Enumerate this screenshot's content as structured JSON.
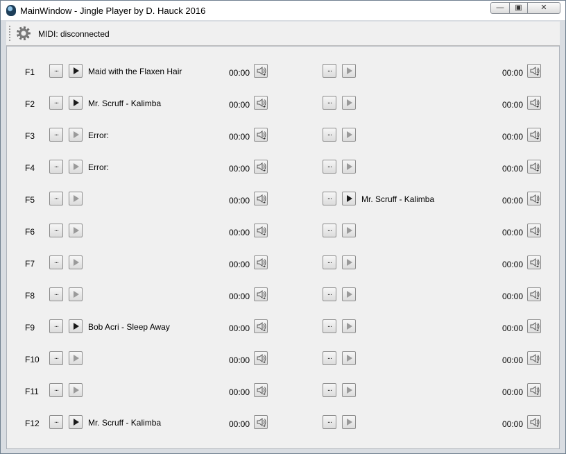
{
  "window": {
    "title": "MainWindow - Jingle Player by D. Hauck 2016"
  },
  "toolbar": {
    "midi_status": "MIDI: disconnected"
  },
  "button_labels": {
    "browse": "..."
  },
  "rows": [
    {
      "key": "F1",
      "left": {
        "track": "Maid with the Flaxen Hair",
        "loaded": true,
        "time": "00:00"
      },
      "right": {
        "track": "",
        "loaded": false,
        "time": "00:00"
      }
    },
    {
      "key": "F2",
      "left": {
        "track": "Mr. Scruff - Kalimba",
        "loaded": true,
        "time": "00:00"
      },
      "right": {
        "track": "",
        "loaded": false,
        "time": "00:00"
      }
    },
    {
      "key": "F3",
      "left": {
        "track": "Error:",
        "loaded": false,
        "time": "00:00"
      },
      "right": {
        "track": "",
        "loaded": false,
        "time": "00:00"
      }
    },
    {
      "key": "F4",
      "left": {
        "track": "Error:",
        "loaded": false,
        "time": "00:00"
      },
      "right": {
        "track": "",
        "loaded": false,
        "time": "00:00"
      }
    },
    {
      "key": "F5",
      "left": {
        "track": "",
        "loaded": false,
        "time": "00:00"
      },
      "right": {
        "track": "Mr. Scruff - Kalimba",
        "loaded": true,
        "time": "00:00"
      }
    },
    {
      "key": "F6",
      "left": {
        "track": "",
        "loaded": false,
        "time": "00:00"
      },
      "right": {
        "track": "",
        "loaded": false,
        "time": "00:00"
      }
    },
    {
      "key": "F7",
      "left": {
        "track": "",
        "loaded": false,
        "time": "00:00"
      },
      "right": {
        "track": "",
        "loaded": false,
        "time": "00:00"
      }
    },
    {
      "key": "F8",
      "left": {
        "track": "",
        "loaded": false,
        "time": "00:00"
      },
      "right": {
        "track": "",
        "loaded": false,
        "time": "00:00"
      }
    },
    {
      "key": "F9",
      "left": {
        "track": "Bob Acri - Sleep Away",
        "loaded": true,
        "time": "00:00"
      },
      "right": {
        "track": "",
        "loaded": false,
        "time": "00:00"
      }
    },
    {
      "key": "F10",
      "left": {
        "track": "",
        "loaded": false,
        "time": "00:00"
      },
      "right": {
        "track": "",
        "loaded": false,
        "time": "00:00"
      }
    },
    {
      "key": "F11",
      "left": {
        "track": "",
        "loaded": false,
        "time": "00:00"
      },
      "right": {
        "track": "",
        "loaded": false,
        "time": "00:00"
      }
    },
    {
      "key": "F12",
      "left": {
        "track": "Mr. Scruff - Kalimba",
        "loaded": true,
        "time": "00:00"
      },
      "right": {
        "track": "",
        "loaded": false,
        "time": "00:00"
      }
    }
  ],
  "colors": {
    "play_enabled": "#1a1a1a",
    "play_disabled": "#9a9a9a"
  }
}
